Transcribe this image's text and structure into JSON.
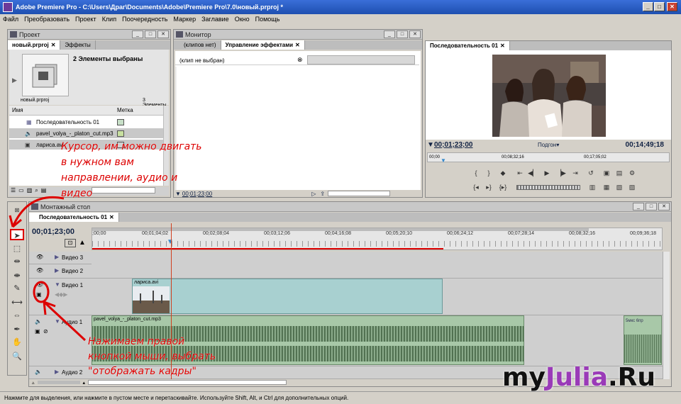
{
  "window": {
    "title": "Adobe Premiere Pro - C:\\Users\\Драг\\Documents\\Adobe\\Premiere Pro\\7.0\\новый.prproj *"
  },
  "menu": [
    "Файл",
    "Преобразовать",
    "Проект",
    "Клип",
    "Поочередность",
    "Маркер",
    "Заглавие",
    "Окно",
    "Помощь"
  ],
  "project": {
    "panel_title": "Проект",
    "tabs": [
      "новый.prproj",
      "Эффекты"
    ],
    "selection_info": "2 Элементы выбраны",
    "file_name": "новый.prproj",
    "count": "3 Элементы",
    "col_name": "Имя",
    "col_label": "Метка",
    "items": [
      "Последовательность 01",
      "pavel_volya_-_platon_cut.mp3",
      "лариса.avi"
    ],
    "label_colors": [
      "#c8e0c8",
      "#c8e0a0",
      "#d0d0d0"
    ]
  },
  "monitor": {
    "panel_title": "Монитор",
    "tabs": [
      "(клипов нет)",
      "Управление эффектами"
    ],
    "no_clip": "(клип не выбран)",
    "timecode": "00;01;23;00"
  },
  "program": {
    "tab": "Последовательность 01",
    "timecode_left": "00;01;23;00",
    "fit": "Подгон",
    "timecode_right": "00;14;49;18",
    "ruler": [
      "00;00",
      "00;08;32;16",
      "00;17;05;02"
    ]
  },
  "timeline": {
    "panel_title": "Монтажный стол",
    "tab": "Последовательность 01",
    "timecode": "00;01;23;00",
    "ticks": [
      ";00;00",
      "00;01;04;02",
      "00;02;08;04",
      "00;03;12;06",
      "00;04;16;08",
      "00;05;20;10",
      "00;06;24;12",
      "00;07;28;14",
      "00;08;32;16",
      "00;09;36;18"
    ],
    "tracks": {
      "video3": "Видео 3",
      "video2": "Видео 2",
      "video1": "Видео 1",
      "audio1": "Аудио 1",
      "audio2": "Аудио 2"
    },
    "clip_video": "лариса.avi",
    "clip_audio": "pavel_volya_-_platon_cut.mp3",
    "clip_right": "5мкс 6пр"
  },
  "annotations": {
    "cursor_text": [
      "Курсор, им можно двигать",
      "в нужном вам",
      "направлении, аудио и",
      "видео"
    ],
    "right_click_text": [
      "Нажимаем правой",
      "кнопкой мыши, выбрать",
      "\"отображать кадры\""
    ]
  },
  "watermark": {
    "text_a": "my",
    "text_b": "Julia",
    "text_c": ".Ru"
  },
  "status": "Нажмите для выделения, или нажмите в пустом месте и перетаскивайте. Используйте Shift, Alt, и Ctrl для дополнительных опций.",
  "colors": {
    "accent_red": "#d00000",
    "clip_video": "#a8d0d0",
    "clip_audio": "#a8c8a8",
    "watermark_purple": "#9a3ab8"
  }
}
